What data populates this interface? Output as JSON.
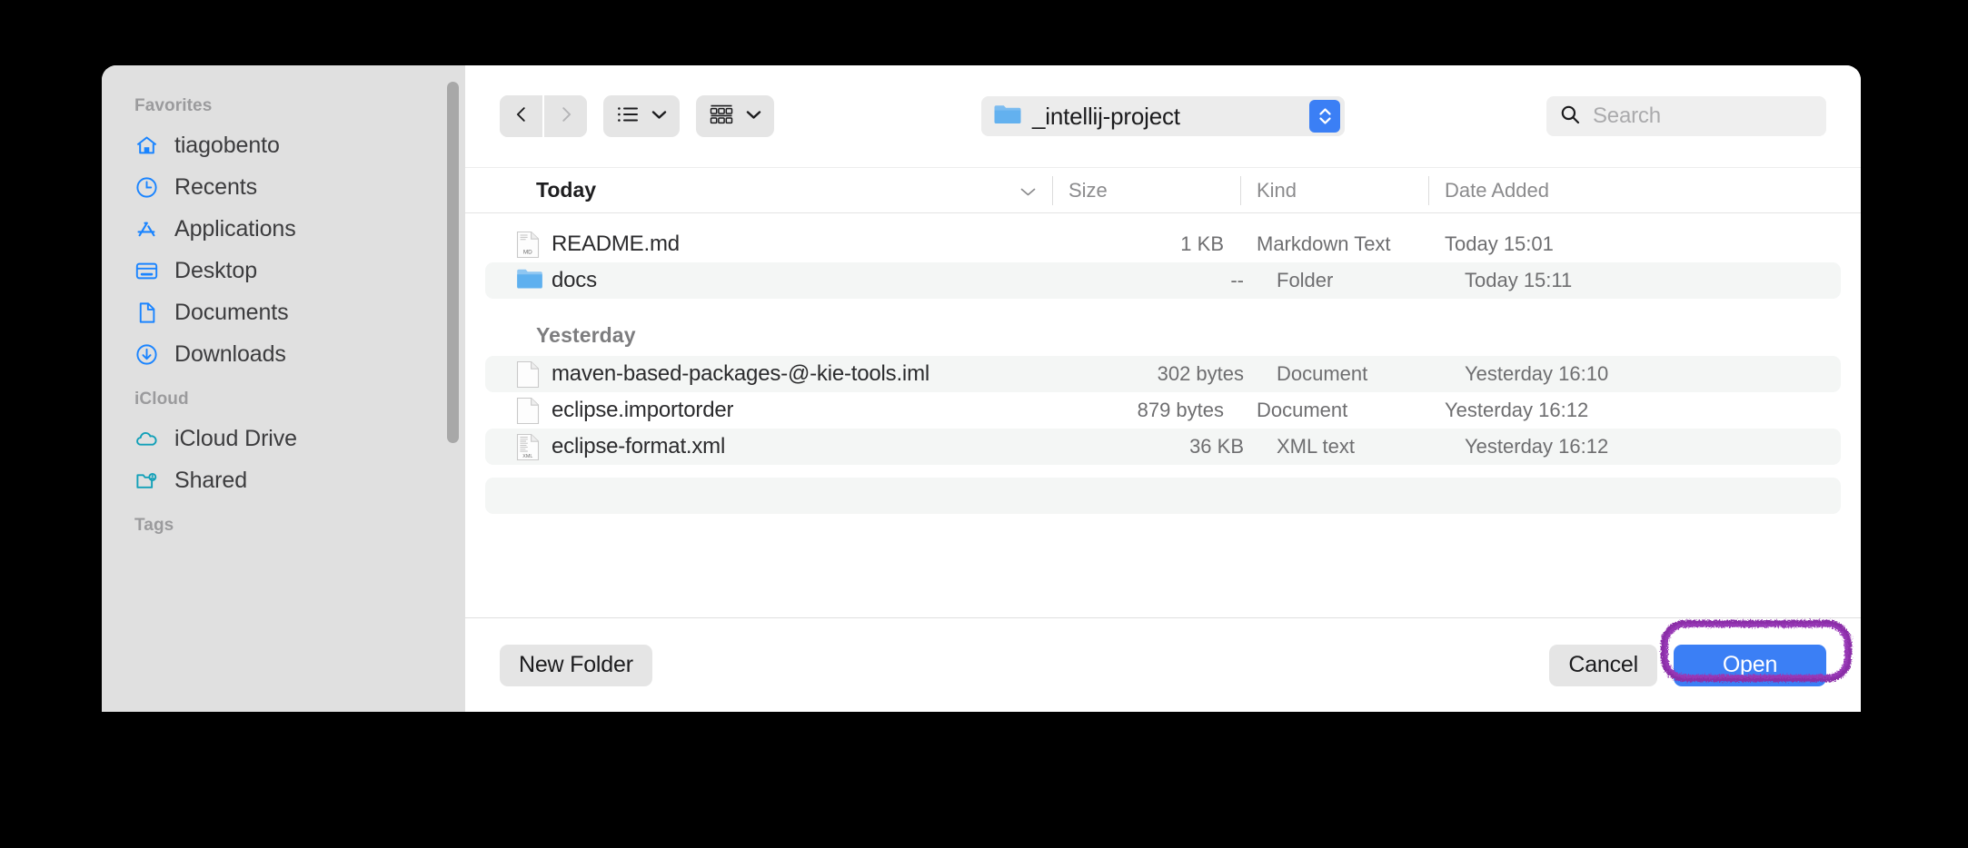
{
  "window": {
    "title": "Open"
  },
  "sidebar": {
    "groups": [
      {
        "title": "Favorites",
        "items": [
          {
            "label": "tiagobento",
            "icon": "home-icon"
          },
          {
            "label": "Recents",
            "icon": "clock-icon"
          },
          {
            "label": "Applications",
            "icon": "applications-icon"
          },
          {
            "label": "Desktop",
            "icon": "desktop-icon"
          },
          {
            "label": "Documents",
            "icon": "document-icon"
          },
          {
            "label": "Downloads",
            "icon": "downloads-icon"
          }
        ]
      },
      {
        "title": "iCloud",
        "items": [
          {
            "label": "iCloud Drive",
            "icon": "cloud-icon"
          },
          {
            "label": "Shared",
            "icon": "shared-folder-icon"
          }
        ]
      },
      {
        "title": "Tags",
        "items": []
      }
    ]
  },
  "toolbar": {
    "back_icon": "chevron-left-icon",
    "forward_icon": "chevron-right-icon",
    "view_list_icon": "list-view-icon",
    "view_group_icon": "group-view-icon",
    "chevron_icon": "chevron-down-icon",
    "path": {
      "label": "_intellij-project",
      "icon": "blue-folder-icon"
    },
    "search": {
      "placeholder": "Search",
      "icon": "search-icon",
      "value": ""
    }
  },
  "columns": {
    "name": "Today",
    "size": "Size",
    "kind": "Kind",
    "date": "Date Added",
    "sort_icon": "chevron-down-icon"
  },
  "groups": [
    {
      "heading": "Today",
      "show_heading": false,
      "rows": [
        {
          "name": "README.md",
          "size": "1 KB",
          "kind": "Markdown Text",
          "date": "Today 15:01",
          "icon": "markdown-file-icon",
          "striped": false
        },
        {
          "name": "docs",
          "size": "--",
          "kind": "Folder",
          "date": "Today 15:11",
          "icon": "blue-folder-icon",
          "striped": true
        }
      ]
    },
    {
      "heading": "Yesterday",
      "show_heading": true,
      "rows": [
        {
          "name": "maven-based-packages-@-kie-tools.iml",
          "size": "302 bytes",
          "kind": "Document",
          "date": "Yesterday 16:10",
          "icon": "plain-file-icon",
          "striped": true
        },
        {
          "name": "eclipse.importorder",
          "size": "879 bytes",
          "kind": "Document",
          "date": "Yesterday 16:12",
          "icon": "plain-file-icon",
          "striped": false
        },
        {
          "name": "eclipse-format.xml",
          "size": "36 KB",
          "kind": "XML text",
          "date": "Yesterday 16:12",
          "icon": "xml-file-icon",
          "striped": true
        }
      ]
    }
  ],
  "footer": {
    "new_folder_label": "New Folder",
    "cancel_label": "Cancel",
    "open_label": "Open"
  },
  "colors": {
    "accent_blue": "#3b7ff5",
    "sidebar_icon_blue": "#1a84ff",
    "icloud_teal": "#12a0b8",
    "annotation_purple": "#8b2fa8",
    "sidebar_bg": "#e0e0e0",
    "row_stripe": "#f4f6f5"
  }
}
